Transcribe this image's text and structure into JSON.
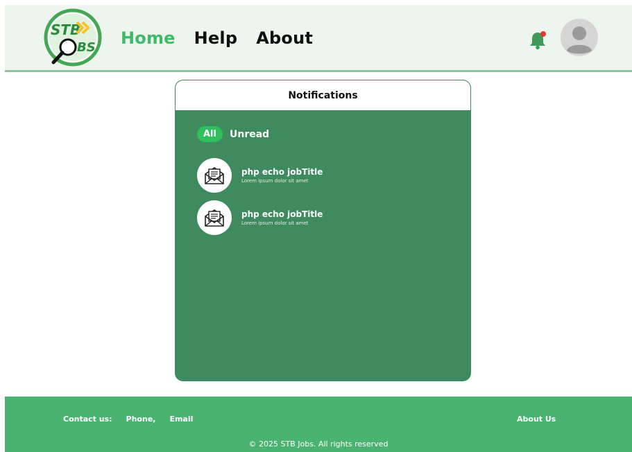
{
  "header": {
    "logo_text_top": "STB",
    "logo_text_bottom": "JOBS",
    "nav": [
      {
        "label": "Home",
        "active": true
      },
      {
        "label": "Help",
        "active": false
      },
      {
        "label": "About",
        "active": false
      }
    ]
  },
  "notifications": {
    "title": "Notifications",
    "tabs": {
      "all": "All",
      "unread": "Unread"
    },
    "items": [
      {
        "title": "php echo jobTitle",
        "subtitle": "Lorem ipsum dolor sit amet",
        "icon": "mail-open-icon"
      },
      {
        "title": "php echo jobTitle",
        "subtitle": "Lorem ipsum dolor sit amet",
        "icon": "mail-open-icon"
      }
    ]
  },
  "footer": {
    "contact_label": "Contact us:",
    "phone": "Phone,",
    "email": "Email",
    "about_us": "About Us",
    "copyright": "© 2025 STB Jobs. All rights reserved"
  },
  "colors": {
    "accent": "#3fba69",
    "panel": "#3f8a5f",
    "footer": "#4bb371",
    "header_bg": "#eef5ee"
  }
}
